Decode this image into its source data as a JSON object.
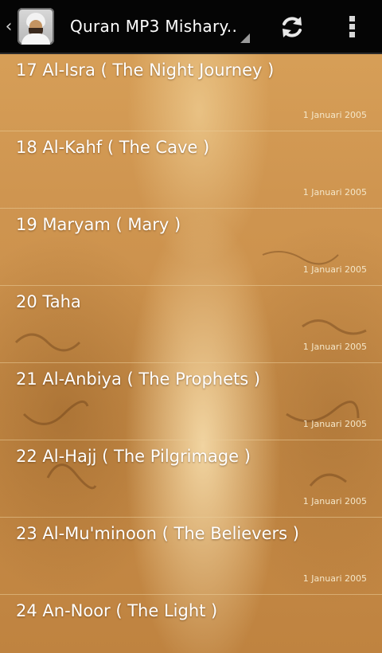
{
  "action_bar": {
    "title": "Quran MP3 Mishary..",
    "up_icon": "chevron-left-icon",
    "app_icon": "reciter-avatar-icon",
    "refresh_icon": "refresh-icon",
    "overflow_icon": "overflow-menu-icon"
  },
  "tracks": [
    {
      "title": "17 Al-Isra ( The Night Journey )",
      "date": "1 Januari 2005"
    },
    {
      "title": "18 Al-Kahf ( The Cave )",
      "date": "1 Januari 2005"
    },
    {
      "title": "19 Maryam ( Mary )",
      "date": "1 Januari 2005"
    },
    {
      "title": "20 Taha",
      "date": "1 Januari 2005"
    },
    {
      "title": "21 Al-Anbiya ( The Prophets )",
      "date": "1 Januari 2005"
    },
    {
      "title": "22 Al-Hajj ( The Pilgrimage )",
      "date": "1 Januari 2005"
    },
    {
      "title": "23 Al-Mu'minoon ( The Believers )",
      "date": "1 Januari 2005"
    },
    {
      "title": "24 An-Noor ( The Light )",
      "date": ""
    }
  ],
  "colors": {
    "action_bar_bg": "#050505",
    "title_text": "#ffffff",
    "list_text": "#ffffff",
    "background_tone": "#c98a45"
  }
}
